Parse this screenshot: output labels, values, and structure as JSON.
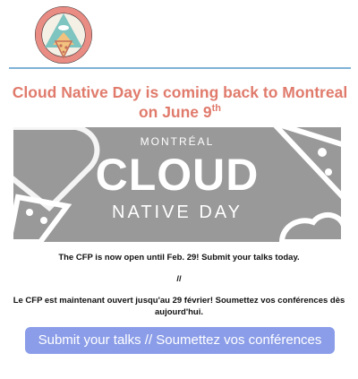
{
  "header": {
    "logo": {
      "icon": "cloud-native-pizza-logo"
    }
  },
  "headline": {
    "text": "Cloud Native Day is coming back to Montreal on June 9",
    "superscript": "th",
    "color": "#e07b6c"
  },
  "banner": {
    "city": "MONTRÉAL",
    "word": "CLOUD",
    "subtitle": "NATIVE DAY",
    "background": "#999999"
  },
  "body": {
    "cfp_en": "The CFP is now open until Feb. 29! Submit your talks today.",
    "separator": "//",
    "cfp_fr": "Le CFP est maintenant ouvert jusqu'au 29 février! Soumettez vos conférences dès aujourd'hui."
  },
  "cta": {
    "label": "Submit your talks // Soumettez vos conférences",
    "color": "#8b9de8"
  }
}
